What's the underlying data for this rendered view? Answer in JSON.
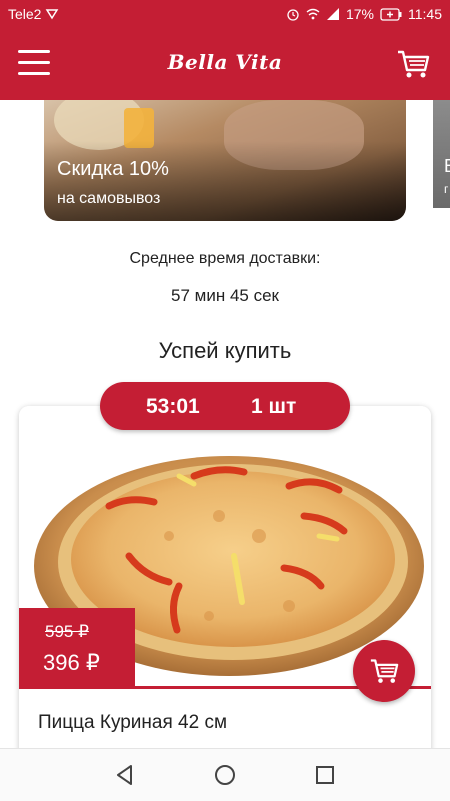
{
  "status_bar": {
    "carrier": "Tele2",
    "battery": "17%",
    "time": "11:45"
  },
  "app_bar": {
    "logo": "Bella Vita"
  },
  "promo": {
    "title": "Скидка  10%",
    "subtitle": "на самовывоз",
    "next_title": "В",
    "next_subtitle": "г"
  },
  "delivery": {
    "label": "Среднее время доставки:",
    "time": "57 мин 45 сек"
  },
  "hurry": {
    "title": "Успей купить",
    "timer": "53:01",
    "quantity": "1 шт",
    "product": {
      "name": "Пицца Куриная 42 см",
      "old_price": "595 ₽",
      "new_price": "396 ₽"
    }
  },
  "colors": {
    "accent": "#c41e34"
  }
}
